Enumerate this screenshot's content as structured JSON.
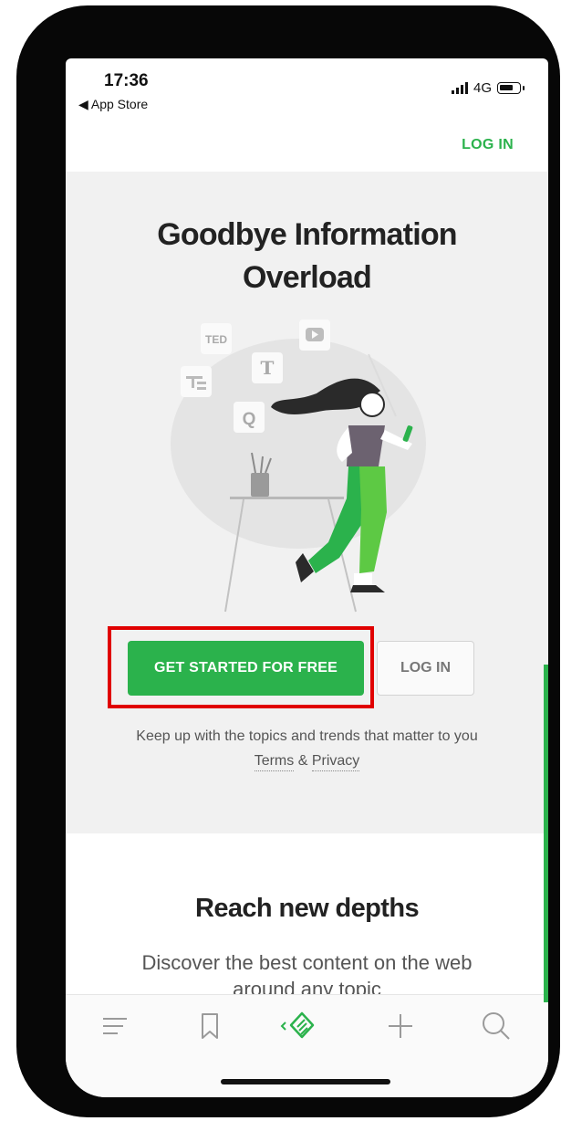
{
  "status_bar": {
    "time": "17:36",
    "back_label": "◀ App Store",
    "network": "4G"
  },
  "header": {
    "login_label": "LOG IN"
  },
  "hero": {
    "title_line1": "Goodbye Information",
    "title_line2": "Overload",
    "illustration_badges": [
      "TED",
      "T",
      "Q"
    ],
    "cta_label": "GET STARTED FOR FREE",
    "login_label": "LOG IN",
    "tagline": "Keep up with the topics and trends that matter to you",
    "terms_label": "Terms",
    "and_label": "&",
    "privacy_label": "Privacy"
  },
  "section2": {
    "title": "Reach new depths",
    "text_line1": "Discover the best content on the web",
    "text_line2": "around any topic"
  },
  "tabbar": {
    "items": [
      "menu-icon",
      "bookmark-icon",
      "feedly-icon",
      "plus-icon",
      "search-icon"
    ]
  },
  "colors": {
    "accent": "#2bb24c",
    "highlight": "#e00000",
    "hero_bg": "#f1f1f1"
  }
}
